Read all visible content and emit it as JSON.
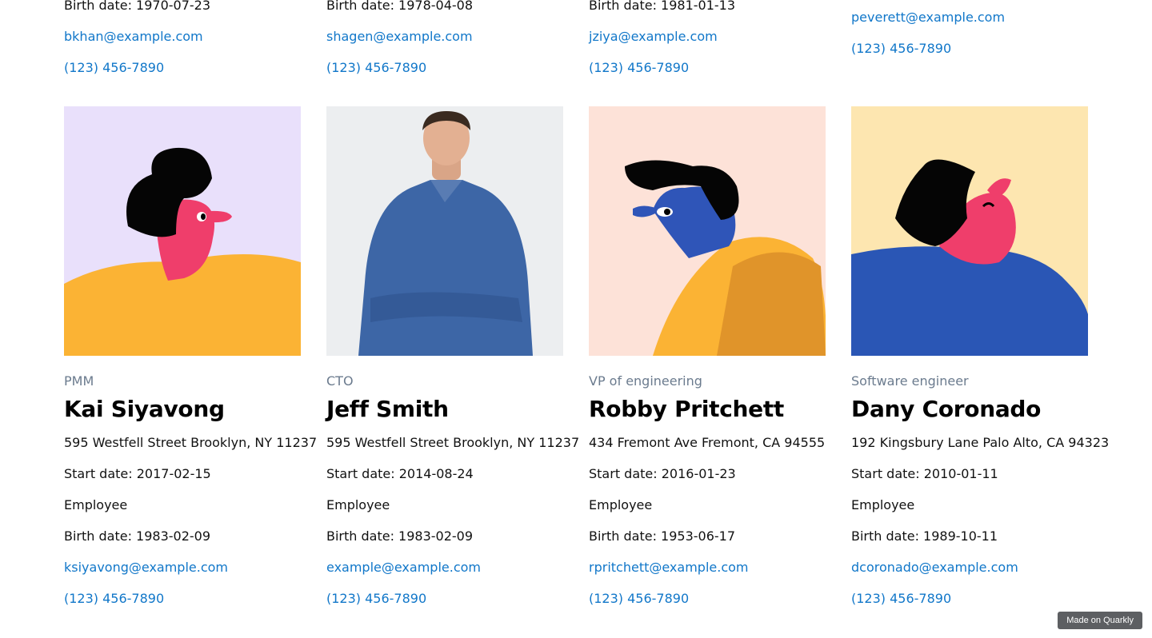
{
  "top_row": [
    {
      "birth": "Birth date: 1970-07-23",
      "email": "bkhan@example.com",
      "phone": "(123) 456-7890"
    },
    {
      "birth": "Birth date: 1978-04-08",
      "email": "shagen@example.com",
      "phone": "(123) 456-7890"
    },
    {
      "birth": "Birth date: 1981-01-13",
      "email": "jziya@example.com",
      "phone": "(123) 456-7890"
    },
    {
      "email": "peverett@example.com",
      "phone": "(123) 456-7890"
    }
  ],
  "members": [
    {
      "role": "PMM",
      "name": "Kai Siyavong",
      "address": "595 Westfell Street Brooklyn, NY 11237",
      "start": "Start date: 2017-02-15",
      "type": "Employee",
      "birth": "Birth date: 1983-02-09",
      "email": "ksiyavong@example.com",
      "phone": "(123) 456-7890",
      "bg": "#e9e0fb"
    },
    {
      "role": "CTO",
      "name": "Jeff Smith",
      "address": "595 Westfell Street Brooklyn, NY 11237",
      "start": "Start date: 2014-08-24",
      "type": "Employee",
      "birth": "Birth date: 1983-02-09",
      "email": "example@example.com",
      "phone": "(123) 456-7890",
      "bg": "#eceef0"
    },
    {
      "role": "VP of engineering",
      "name": "Robby Pritchett",
      "address": "434 Fremont Ave Fremont, CA 94555",
      "start": "Start date: 2016-01-23",
      "type": "Employee",
      "birth": "Birth date: 1953-06-17",
      "email": "rpritchett@example.com",
      "phone": "(123) 456-7890",
      "bg": "#fde2d8"
    },
    {
      "role": "Software engineer",
      "name": "Dany Coronado",
      "address": "192 Kingsbury Lane Palo Alto, CA 94323",
      "start": "Start date: 2010-01-11",
      "type": "Employee",
      "birth": "Birth date: 1989-10-11",
      "email": "dcoronado@example.com",
      "phone": "(123) 456-7890",
      "bg": "#fde6b0"
    }
  ],
  "badge": "Made on Quarkly"
}
